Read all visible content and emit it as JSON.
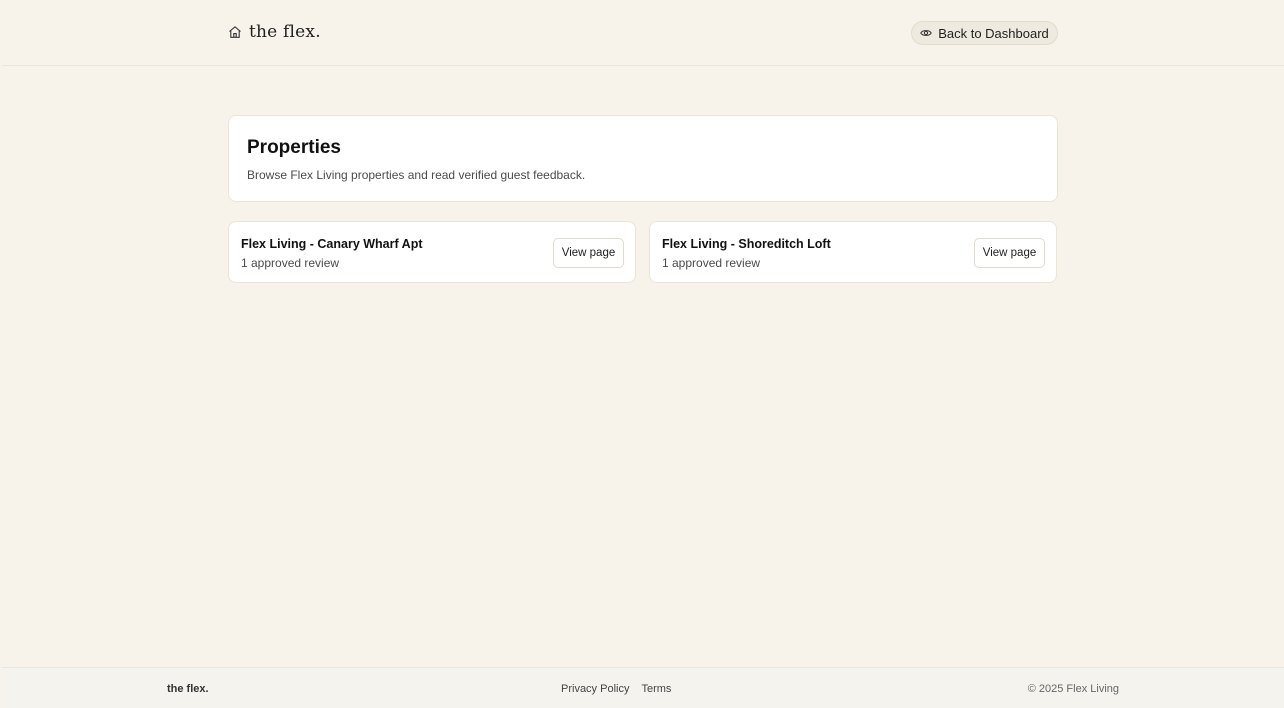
{
  "header": {
    "brand": "the flex.",
    "brand_icon": "home-icon",
    "back_button_label": "Back to Dashboard",
    "back_button_icon": "eye-icon"
  },
  "hero": {
    "title": "Properties",
    "subtitle": "Browse Flex Living properties and read verified guest feedback."
  },
  "properties": [
    {
      "name": "Flex Living - Canary Wharf Apt",
      "review_count": "1 approved review",
      "button_label": "View page"
    },
    {
      "name": "Flex Living - Shoreditch Loft",
      "review_count": "1 approved review",
      "button_label": "View page"
    }
  ],
  "footer": {
    "brand": "the flex.",
    "links": [
      "Privacy Policy",
      "Terms"
    ],
    "copyright": "© 2025 Flex Living"
  },
  "colors": {
    "background": "#f7f3ea",
    "card": "#ffffff",
    "pill": "#efeadf"
  }
}
